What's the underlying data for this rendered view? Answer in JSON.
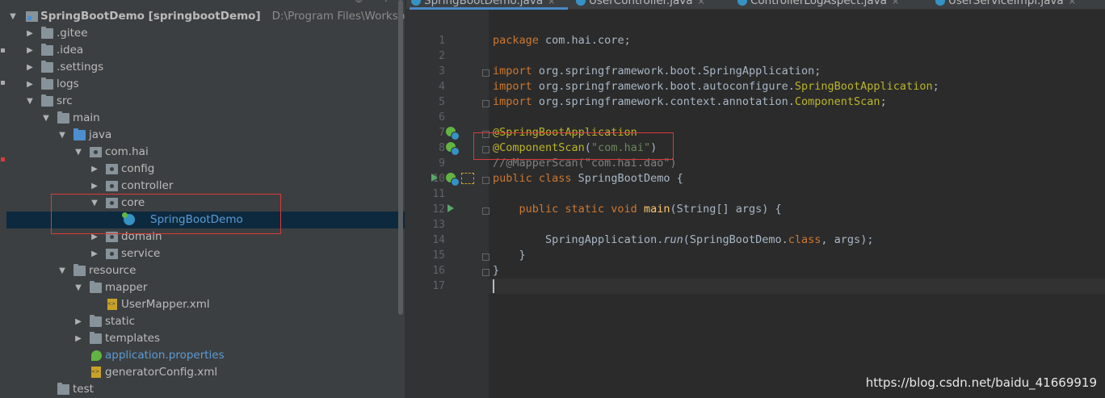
{
  "project_tree": {
    "header_icons": "⊕ ÷",
    "rows": [
      {
        "label": "SpringBootDemo [springbootDemo]",
        "path": "D:\\Program Files\\Workspa",
        "icon": "module-icon",
        "expanded": true
      },
      {
        "label": ".gitee",
        "icon": "folder-icon",
        "expanded": false
      },
      {
        "label": ".idea",
        "icon": "folder-icon",
        "expanded": false
      },
      {
        "label": ".settings",
        "icon": "folder-icon",
        "expanded": false
      },
      {
        "label": "logs",
        "icon": "folder-icon",
        "expanded": false
      },
      {
        "label": "src",
        "icon": "folder-icon",
        "expanded": true
      },
      {
        "label": "main",
        "icon": "folder-icon",
        "expanded": true
      },
      {
        "label": "java",
        "icon": "source-folder-icon",
        "expanded": true
      },
      {
        "label": "com.hai",
        "icon": "package-icon",
        "expanded": true
      },
      {
        "label": "config",
        "icon": "package-icon",
        "expanded": false
      },
      {
        "label": "controller",
        "icon": "package-icon",
        "expanded": false
      },
      {
        "label": "core",
        "icon": "package-icon",
        "expanded": true
      },
      {
        "label": "SpringBootDemo",
        "icon": "spring-class-icon",
        "selected": true
      },
      {
        "label": "domain",
        "icon": "package-icon",
        "expanded": false
      },
      {
        "label": "service",
        "icon": "package-icon",
        "expanded": false
      },
      {
        "label": "resource",
        "icon": "folder-icon",
        "expanded": true
      },
      {
        "label": "mapper",
        "icon": "folder-icon",
        "expanded": true
      },
      {
        "label": "UserMapper.xml",
        "icon": "xml-file-icon"
      },
      {
        "label": "static",
        "icon": "folder-icon",
        "expanded": false
      },
      {
        "label": "templates",
        "icon": "folder-icon",
        "expanded": false
      },
      {
        "label": "application.properties",
        "icon": "properties-file-icon"
      },
      {
        "label": "generatorConfig.xml",
        "icon": "xml-file-icon"
      },
      {
        "label": "test",
        "icon": "folder-icon"
      }
    ]
  },
  "tabs": [
    {
      "label": "SpringBootDemo.java",
      "close": "×",
      "active": true
    },
    {
      "label": "UserController.java",
      "close": "×",
      "active": false
    },
    {
      "label": "ControllerLogAspect.java",
      "close": "×",
      "active": false
    },
    {
      "label": "UserServiceImpl.java",
      "close": "×",
      "active": false
    }
  ],
  "editor": {
    "line_numbers": [
      "1",
      "2",
      "3",
      "4",
      "5",
      "6",
      "7",
      "8",
      "9",
      "10",
      "11",
      "12",
      "13",
      "14",
      "15",
      "16",
      "17"
    ],
    "lines": {
      "l1_kw": "package",
      "l1_rest": " com.hai.core;",
      "l3_kw": "import",
      "l3_rest": " org.springframework.boot.SpringApplication;",
      "l4_kw": "import",
      "l4_rest": " org.springframework.boot.autoconfigure.",
      "l4_cls": "SpringBootApplication",
      "l4_end": ";",
      "l5_kw": "import",
      "l5_rest": " org.springframework.context.annotation.",
      "l5_cls": "ComponentScan",
      "l5_end": ";",
      "l7_ann": "@SpringBootApplication",
      "l8_ann": "@ComponentScan",
      "l8_open": "(",
      "l8_str": "\"com.hai\"",
      "l8_close": ")",
      "l9_cmt": "//@MapperScan(\"com.hai.dao\")",
      "l10_kw": "public class",
      "l10_rest": " SpringBootDemo {",
      "l12_indent": "    ",
      "l12_kw": "public static void",
      "l12_sp": " ",
      "l12_method": "main",
      "l12_rest": "(String[] args) {",
      "l14_indent": "        ",
      "l14_cls": "SpringApplication.",
      "l14_run": "run",
      "l14_args": "(SpringBootDemo.",
      "l14_kw": "class",
      "l14_end": ", args);",
      "l15_text": "    }",
      "l16_text": "}"
    }
  },
  "watermark": "https://blog.csdn.net/baidu_41669919",
  "colors": {
    "keyword": "#cc7832",
    "annotation": "#bbb529",
    "string": "#6a8759",
    "comment": "#808080",
    "highlight_box": "#d93b3b",
    "selection": "#0d293e"
  }
}
